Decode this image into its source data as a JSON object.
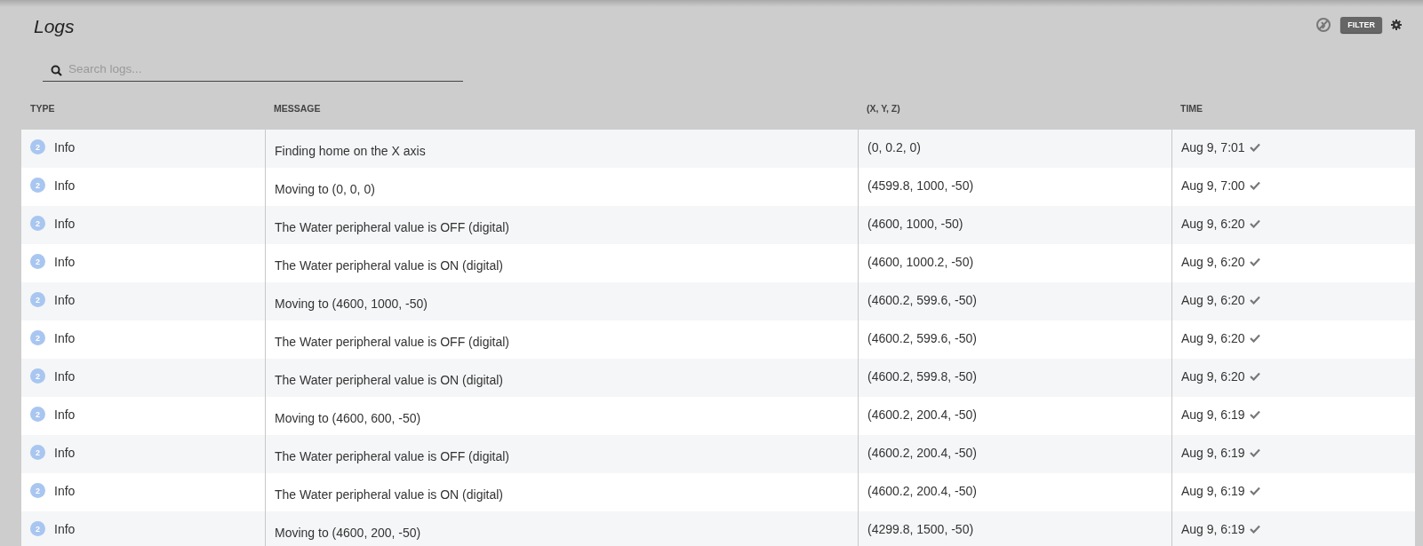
{
  "title": "Logs",
  "toolbar": {
    "filter_button": "FILTER"
  },
  "search": {
    "placeholder": "Search logs..."
  },
  "table": {
    "columns": [
      "TYPE",
      "MESSAGE",
      "(X, Y, Z)",
      "TIME"
    ],
    "rows": [
      {
        "verbosity": "2",
        "type": "Info",
        "message": "Finding home on the X axis",
        "position": "(0, 0.2, 0)",
        "time": "Aug 9, 7:01"
      },
      {
        "verbosity": "2",
        "type": "Info",
        "message": "Moving to (0, 0, 0)",
        "position": "(4599.8, 1000, -50)",
        "time": "Aug 9, 7:00"
      },
      {
        "verbosity": "2",
        "type": "Info",
        "message": "The Water peripheral value is OFF (digital)",
        "position": "(4600, 1000, -50)",
        "time": "Aug 9, 6:20"
      },
      {
        "verbosity": "2",
        "type": "Info",
        "message": "The Water peripheral value is ON (digital)",
        "position": "(4600, 1000.2, -50)",
        "time": "Aug 9, 6:20"
      },
      {
        "verbosity": "2",
        "type": "Info",
        "message": "Moving to (4600, 1000, -50)",
        "position": "(4600.2, 599.6, -50)",
        "time": "Aug 9, 6:20"
      },
      {
        "verbosity": "2",
        "type": "Info",
        "message": "The Water peripheral value is OFF (digital)",
        "position": "(4600.2, 599.6, -50)",
        "time": "Aug 9, 6:20"
      },
      {
        "verbosity": "2",
        "type": "Info",
        "message": "The Water peripheral value is ON (digital)",
        "position": "(4600.2, 599.8, -50)",
        "time": "Aug 9, 6:20"
      },
      {
        "verbosity": "2",
        "type": "Info",
        "message": "Moving to (4600, 600, -50)",
        "position": "(4600.2, 200.4, -50)",
        "time": "Aug 9, 6:19"
      },
      {
        "verbosity": "2",
        "type": "Info",
        "message": "The Water peripheral value is OFF (digital)",
        "position": "(4600.2, 200.4, -50)",
        "time": "Aug 9, 6:19"
      },
      {
        "verbosity": "2",
        "type": "Info",
        "message": "The Water peripheral value is ON (digital)",
        "position": "(4600.2, 200.4, -50)",
        "time": "Aug 9, 6:19"
      },
      {
        "verbosity": "2",
        "type": "Info",
        "message": "Moving to (4600, 200, -50)",
        "position": "(4299.8, 1500, -50)",
        "time": "Aug 9, 6:19"
      }
    ]
  }
}
